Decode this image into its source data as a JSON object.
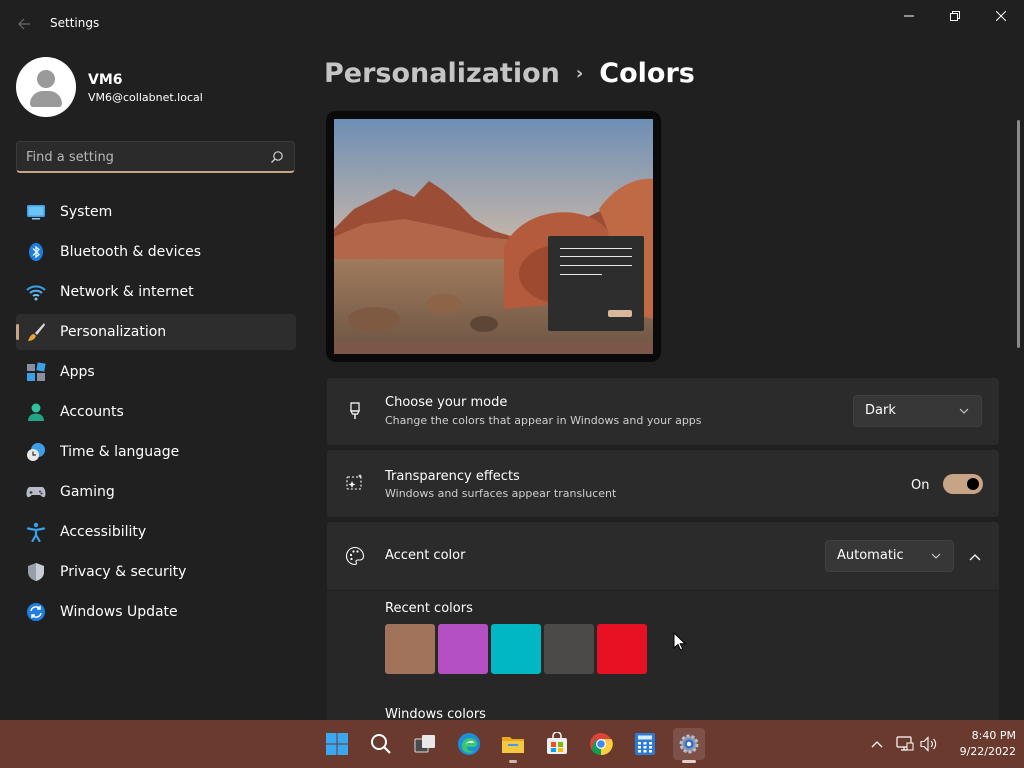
{
  "window": {
    "title": "Settings",
    "minimize_label": "Minimize",
    "maximize_label": "Restore",
    "close_label": "Close"
  },
  "user": {
    "name": "VM6",
    "email": "VM6@collabnet.local"
  },
  "search": {
    "placeholder": "Find a setting",
    "value": ""
  },
  "sidebar": {
    "items": [
      {
        "label": "System",
        "icon": "system-icon",
        "active": false
      },
      {
        "label": "Bluetooth & devices",
        "icon": "bluetooth-icon",
        "active": false
      },
      {
        "label": "Network & internet",
        "icon": "wifi-icon",
        "active": false
      },
      {
        "label": "Personalization",
        "icon": "paintbrush-icon",
        "active": true
      },
      {
        "label": "Apps",
        "icon": "apps-icon",
        "active": false
      },
      {
        "label": "Accounts",
        "icon": "accounts-icon",
        "active": false
      },
      {
        "label": "Time & language",
        "icon": "clock-globe-icon",
        "active": false
      },
      {
        "label": "Gaming",
        "icon": "gamepad-icon",
        "active": false
      },
      {
        "label": "Accessibility",
        "icon": "accessibility-icon",
        "active": false
      },
      {
        "label": "Privacy & security",
        "icon": "shield-icon",
        "active": false
      },
      {
        "label": "Windows Update",
        "icon": "update-icon",
        "active": false
      }
    ]
  },
  "breadcrumb": {
    "parent": "Personalization",
    "separator": "›",
    "current": "Colors"
  },
  "settings": {
    "mode": {
      "title": "Choose your mode",
      "description": "Change the colors that appear in Windows and your apps",
      "value": "Dark",
      "icon": "paint-bucket-icon"
    },
    "transparency": {
      "title": "Transparency effects",
      "description": "Windows and surfaces appear translucent",
      "state_label": "On",
      "enabled": true,
      "icon": "transparency-sparkle-icon"
    },
    "accent": {
      "title": "Accent color",
      "value": "Automatic",
      "expanded": true,
      "icon": "palette-icon",
      "recent_label": "Recent colors",
      "recent_colors": [
        "#a0735a",
        "#b44fc4",
        "#00b7c3",
        "#4c4a48",
        "#e81123"
      ],
      "windows_label": "Windows colors"
    }
  },
  "theme": {
    "accent": "#c8a487",
    "background": "#202020",
    "card": "#2b2b2b",
    "taskbar": "#6b3a2f"
  },
  "taskbar": {
    "apps": [
      {
        "name": "start-button",
        "active": false
      },
      {
        "name": "search-button",
        "active": false
      },
      {
        "name": "task-view-button",
        "active": false
      },
      {
        "name": "edge-app",
        "active": false
      },
      {
        "name": "file-explorer-app",
        "active": false,
        "running": true
      },
      {
        "name": "store-app",
        "active": false
      },
      {
        "name": "chrome-app",
        "active": false
      },
      {
        "name": "calculator-app",
        "active": false
      },
      {
        "name": "settings-app",
        "active": true,
        "running": true
      }
    ],
    "time": "8:40 PM",
    "date": "9/22/2022"
  }
}
